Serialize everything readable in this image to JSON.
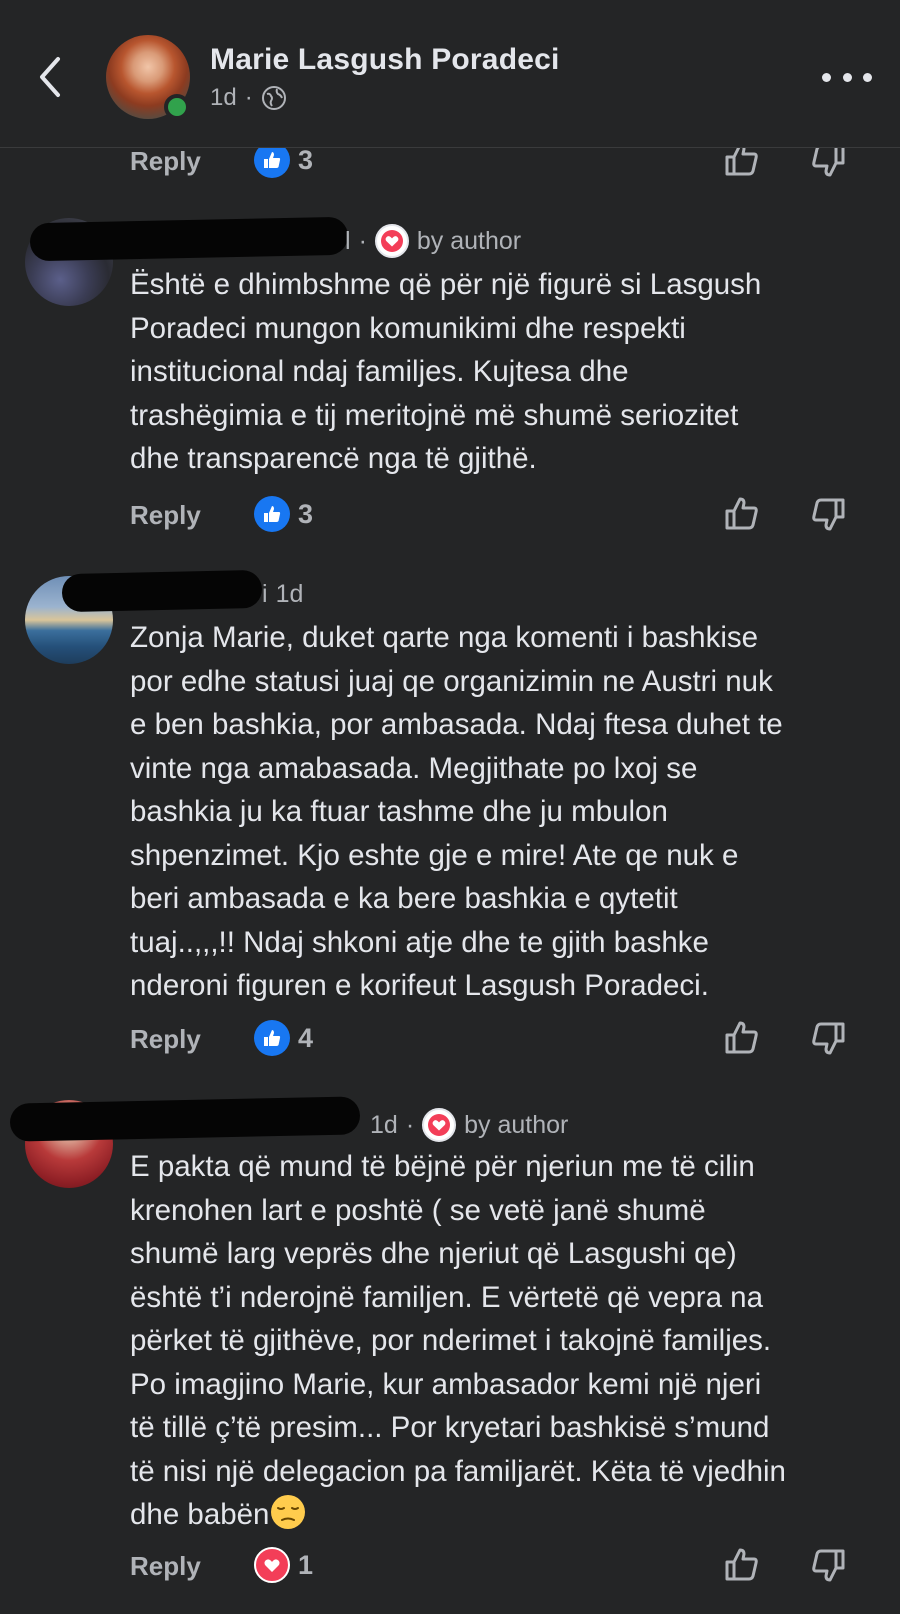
{
  "header": {
    "name": "Marie Lasgush Poradeci",
    "time": "1d",
    "separator": "·"
  },
  "comments": [
    {
      "partial_author_fragment": "",
      "time": "",
      "badge": "",
      "text": "",
      "reply_label": "Reply",
      "reaction": "like",
      "reaction_count": "3"
    },
    {
      "partial_author_fragment": "l",
      "separator": "·",
      "badge": "by author",
      "text": "Është e dhimbshme që për një figurë si Lasgush\nPoradeci mungon komunikimi dhe respekti\ninstitucional ndaj familjes. Kujtesa dhe\ntrashëgimia e tij meritojnë më shumë seriozitet\ndhe transparencë nga të gjithë.",
      "reply_label": "Reply",
      "reaction": "like",
      "reaction_count": "3"
    },
    {
      "partial_author_fragment": "i",
      "time": "1d",
      "text": "Zonja Marie, duket qarte nga komenti i bashkise\npor edhe statusi juaj qe organizimin ne Austri nuk\ne ben bashkia, por ambasada. Ndaj ftesa duhet te\nvinte nga amabasada. Megjithate po lxoj se\nbashkia ju ka ftuar tashme dhe ju mbulon\nshpenzimet. Kjo eshte gje e mire! Ate qe nuk e\nberi ambasada e ka bere bashkia e qytetit\ntuaj..,,,!! Ndaj shkoni atje dhe te gjith bashke\nnderoni figuren e korifeut Lasgush Poradeci.",
      "reply_label": "Reply",
      "reaction": "like",
      "reaction_count": "4"
    },
    {
      "partial_author_fragment": "1d",
      "separator": "·",
      "badge": "by author",
      "text": "E pakta që mund të bëjnë për njeriun me të cilin\nkrenohen lart e poshtë ( se vetë janë shumë\nshumë larg veprës dhe njeriut që Lasgushi qe)\nështë t’i nderojnë familjen. E vërtetë që vepra na\npërket të gjithëve, por nderimet i takojnë familjes.\nPo imagjino Marie, kur ambasador kemi një njeri\ntë tillë ç’të presim... Por kryetari bashkisë s’mund\ntë nisi një delegacion pa familjarët. Këta të vjedhin\ndhe babën",
      "emoji": "pensive-face",
      "reply_label": "Reply",
      "reaction": "love",
      "reaction_count": "1"
    }
  ],
  "icons": [
    "back-arrow-icon",
    "globe-icon",
    "more-icon",
    "like-icon",
    "love-icon",
    "thumbs-up-icon",
    "thumbs-down-icon"
  ],
  "colors": {
    "background": "#242526",
    "text": "#e4e6eb",
    "muted": "#b0b3b8",
    "like": "#1877f2",
    "love": "#f33e58",
    "online": "#31a24c"
  }
}
